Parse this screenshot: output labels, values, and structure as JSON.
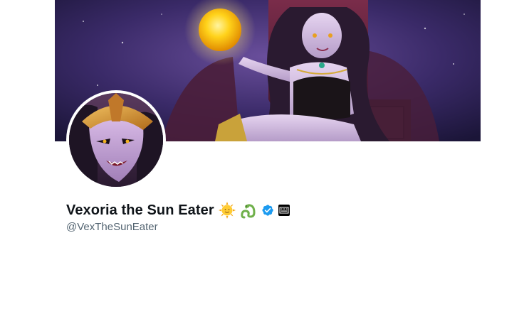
{
  "profile": {
    "display_name": "Vexoria the Sun Eater",
    "handle": "@VexTheSunEater"
  },
  "icons": {
    "emoji_1": "sun-with-face-icon",
    "emoji_2": "snake-icon",
    "verified": "verified-badge-icon",
    "affiliation": "affiliation-badge-icon"
  },
  "colors": {
    "verified_blue": "#1d9bf0",
    "name_text": "#0f1419",
    "handle_text": "#536471",
    "background": "#ffffff"
  }
}
